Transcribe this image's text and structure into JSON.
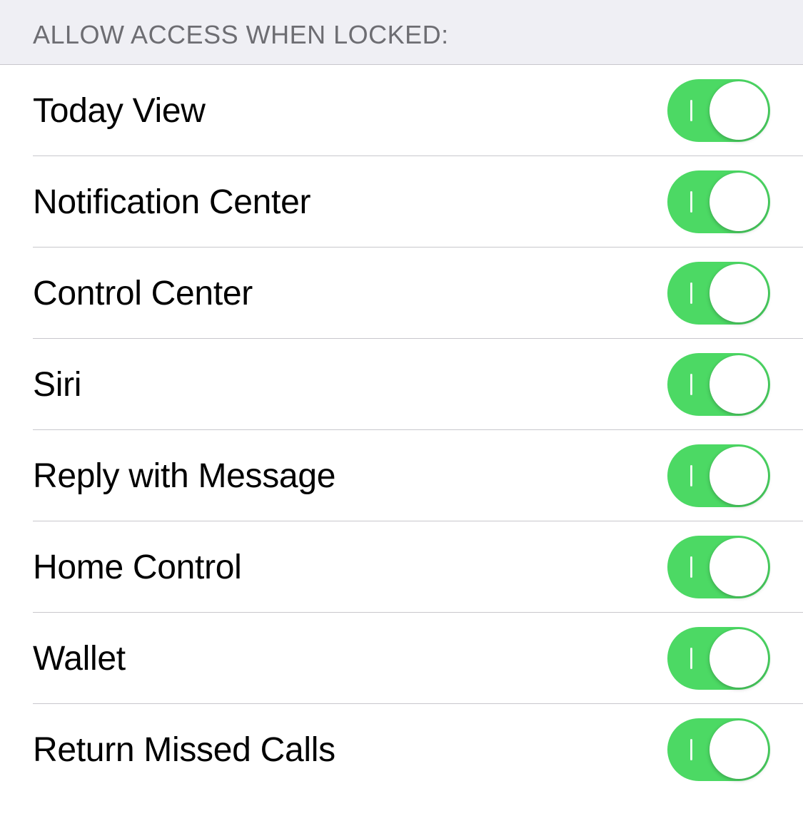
{
  "section": {
    "header": "ALLOW ACCESS WHEN LOCKED:"
  },
  "items": [
    {
      "id": "today-view",
      "label": "Today View",
      "enabled": true
    },
    {
      "id": "notification-center",
      "label": "Notification Center",
      "enabled": true
    },
    {
      "id": "control-center",
      "label": "Control Center",
      "enabled": true
    },
    {
      "id": "siri",
      "label": "Siri",
      "enabled": true
    },
    {
      "id": "reply-with-message",
      "label": "Reply with Message",
      "enabled": true
    },
    {
      "id": "home-control",
      "label": "Home Control",
      "enabled": true
    },
    {
      "id": "wallet",
      "label": "Wallet",
      "enabled": true
    },
    {
      "id": "return-missed-calls",
      "label": "Return Missed Calls",
      "enabled": true
    }
  ],
  "colors": {
    "switch_on": "#4cd964",
    "background_header": "#efeff4",
    "divider": "#c8c7cc",
    "header_text": "#6d6d72"
  }
}
